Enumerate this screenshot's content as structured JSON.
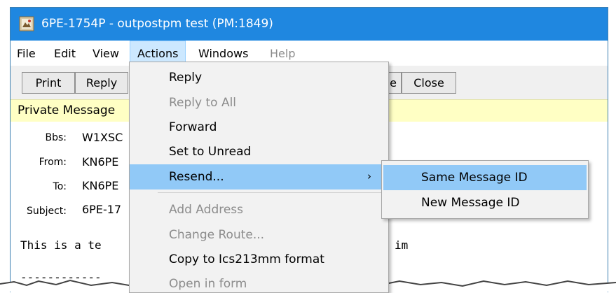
{
  "window": {
    "title": "6PE-1754P - outpostpm test  (PM:1849)",
    "icon": "app-document-icon"
  },
  "menubar": {
    "items": [
      {
        "label": "File"
      },
      {
        "label": "Edit"
      },
      {
        "label": "View"
      },
      {
        "label": "Actions",
        "active": true
      },
      {
        "label": "Windows"
      },
      {
        "label": "Help",
        "disabled": true
      }
    ]
  },
  "toolbar": {
    "buttons": [
      {
        "label": "Print"
      },
      {
        "label": "Reply"
      },
      {
        "label": "e"
      },
      {
        "label": "Close"
      }
    ]
  },
  "banner": {
    "text": "Private Message",
    "color": "#ffffc4"
  },
  "header": {
    "bbs": {
      "label": "Bbs:",
      "value": "W1XSC"
    },
    "from": {
      "label": "From:",
      "value": "KN6PE"
    },
    "to": {
      "label": "To:",
      "value": "KN6PE"
    },
    "subject": {
      "label": "Subject:",
      "value": "6PE-17"
    }
  },
  "body": {
    "line1_left": "This is a te",
    "line1_right": "im",
    "separator": "------------"
  },
  "actions_menu": {
    "items": [
      {
        "label": "Reply"
      },
      {
        "label": "Reply to All",
        "disabled": true
      },
      {
        "label": "Forward"
      },
      {
        "label": "Set to Unread"
      },
      {
        "label": "Resend...",
        "highlighted": true,
        "submenu_arrow": "›"
      },
      {
        "label": "Add Address",
        "disabled": true
      },
      {
        "label": "Change Route...",
        "disabled": true
      },
      {
        "label": "Copy to Ics213mm format"
      },
      {
        "label": "Open in form",
        "disabled": true
      }
    ]
  },
  "resend_submenu": {
    "items": [
      {
        "label": "Same Message ID",
        "highlighted": true
      },
      {
        "label": "New Message ID"
      }
    ]
  },
  "colors": {
    "titlebar": "#1f87e0",
    "highlight": "#91c9f7",
    "menu_active": "#cce8ff"
  }
}
